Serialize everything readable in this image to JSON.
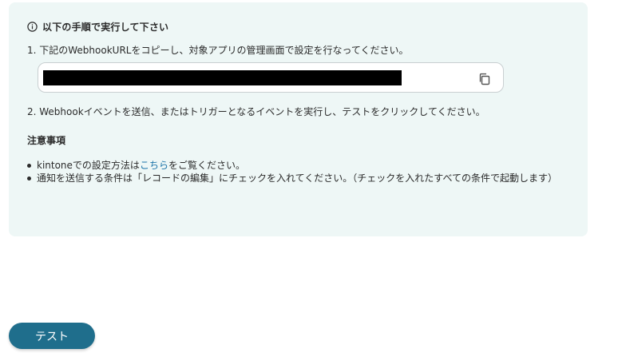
{
  "instructions": {
    "heading": "以下の手順で実行して下さい",
    "step1": "1. 下記のWebhookURLをコピーし、対象アプリの管理画面で設定を行なってください。",
    "webhook_url": "",
    "step2": "2. Webhookイベントを送信、またはトリガーとなるイベントを実行し、テストをクリックしてください。"
  },
  "notes": {
    "title": "注意事項",
    "item1_prefix": "kintoneでの設定方法は",
    "item1_link": "こちら",
    "item1_suffix": "をご覧ください。",
    "item2": "通知を送信する条件は「レコードの編集」にチェックを入れてください。（チェックを入れたすべての条件で起動します）"
  },
  "actions": {
    "test_label": "テスト"
  },
  "icons": {
    "heading": "info-icon",
    "copy": "copy-icon"
  },
  "colors": {
    "panel_bg": "#eef7f6",
    "accent": "#1f6e8c",
    "link": "#1a73a8"
  }
}
